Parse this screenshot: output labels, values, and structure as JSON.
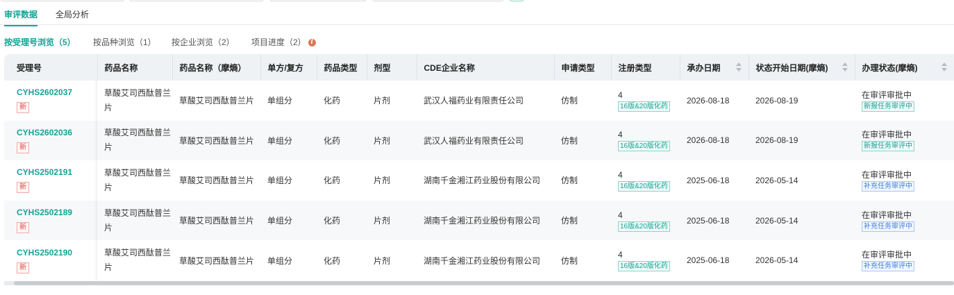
{
  "main_tabs": [
    {
      "label": "审评数据",
      "active": true
    },
    {
      "label": "全局分析",
      "active": false
    }
  ],
  "sub_tabs": [
    {
      "label": "按受理号浏览（5）",
      "active": true
    },
    {
      "label": "按品种浏览（1）",
      "active": false
    },
    {
      "label": "按企业浏览（2）",
      "active": false
    },
    {
      "label": "项目进度（2）",
      "active": false
    }
  ],
  "info_icon": "info-icon",
  "table": {
    "columns": [
      "受理号",
      "药品名称",
      "药品名称（摩熵）",
      "单方/复方",
      "药品类型",
      "剂型",
      "CDE企业名称",
      "申请类型",
      "注册类型",
      "承办日期",
      "状态开始日期(摩熵)",
      "办理状态(摩熵)"
    ],
    "rows": [
      {
        "id": "CYHS2602037",
        "badge": "新",
        "name": "草酸艾司西酞普兰片",
        "name_ms": "草酸艾司西酞普兰片",
        "compound": "单组分",
        "drug_type": "化药",
        "form": "片剂",
        "company": "武汉人福药业有限责任公司",
        "apply_type": "仿制",
        "reg_num": "4",
        "reg_tag": "16版&20版化药",
        "handle_date": "2026-08-18",
        "status_date": "2026-08-19",
        "status": "在审评审批中",
        "status_tag": "新报任务审评中"
      },
      {
        "id": "CYHS2602036",
        "badge": "新",
        "name": "草酸艾司西酞普兰片",
        "name_ms": "草酸艾司西酞普兰片",
        "compound": "单组分",
        "drug_type": "化药",
        "form": "片剂",
        "company": "武汉人福药业有限责任公司",
        "apply_type": "仿制",
        "reg_num": "4",
        "reg_tag": "16版&20版化药",
        "handle_date": "2026-08-18",
        "status_date": "2026-08-19",
        "status": "在审评审批中",
        "status_tag": "新报任务审评中"
      },
      {
        "id": "CYHS2502191",
        "badge": "新",
        "name": "草酸艾司西酞普兰片",
        "name_ms": "草酸艾司西酞普兰片",
        "compound": "单组分",
        "drug_type": "化药",
        "form": "片剂",
        "company": "湖南千金湘江药业股份有限公司",
        "apply_type": "仿制",
        "reg_num": "4",
        "reg_tag": "16版&20版化药",
        "handle_date": "2025-06-18",
        "status_date": "2026-05-14",
        "status": "在审评审批中",
        "status_tag": "补充任务审评中"
      },
      {
        "id": "CYHS2502189",
        "badge": "新",
        "name": "草酸艾司西酞普兰片",
        "name_ms": "草酸艾司西酞普兰片",
        "compound": "单组分",
        "drug_type": "化药",
        "form": "片剂",
        "company": "湖南千金湘江药业股份有限公司",
        "apply_type": "仿制",
        "reg_num": "4",
        "reg_tag": "16版&20版化药",
        "handle_date": "2025-06-18",
        "status_date": "2026-05-14",
        "status": "在审评审批中",
        "status_tag": "补充任务审评中"
      },
      {
        "id": "CYHS2502190",
        "badge": "新",
        "name": "草酸艾司西酞普兰片",
        "name_ms": "草酸艾司西酞普兰片",
        "compound": "单组分",
        "drug_type": "化药",
        "form": "片剂",
        "company": "湖南千金湘江药业股份有限公司",
        "apply_type": "仿制",
        "reg_num": "4",
        "reg_tag": "16版&20版化药",
        "handle_date": "2025-06-18",
        "status_date": "2026-05-14",
        "status": "在审评审批中",
        "status_tag": "补充任务审评中"
      }
    ]
  },
  "colors": {
    "accent": "#14a394",
    "badge_red": "#e04848",
    "tag_blue": "#3f7fe0"
  }
}
